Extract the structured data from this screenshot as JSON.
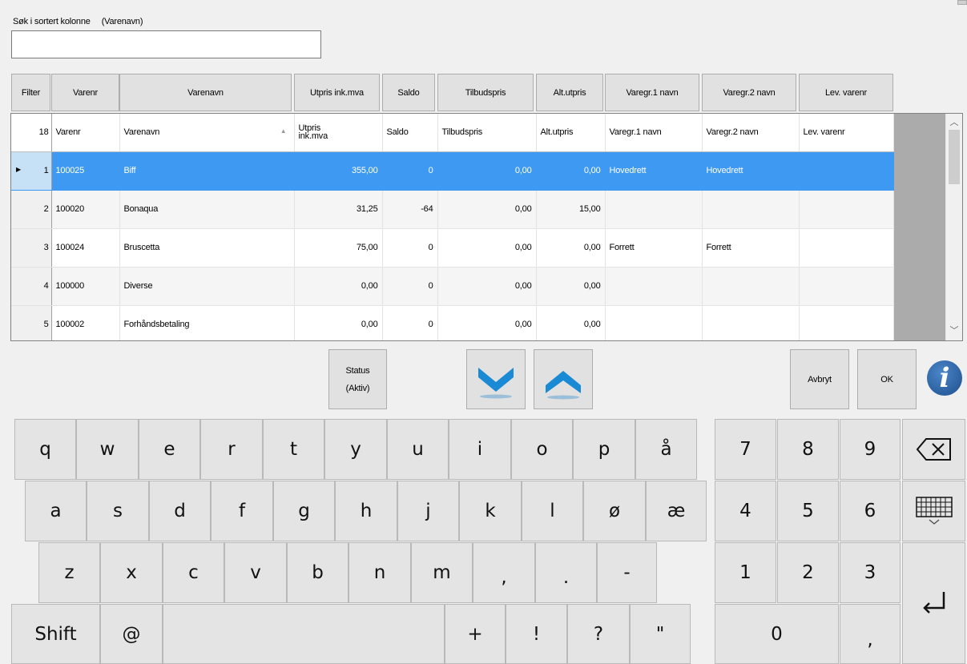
{
  "search": {
    "label": "Søk i sortert kolonne",
    "column_label": "(Varenavn)",
    "value": ""
  },
  "filter_buttons": [
    "Filter",
    "Varenr",
    "Varenavn",
    "Utpris ink.mva",
    "Saldo",
    "Tilbudspris",
    "Alt.utpris",
    "Varegr.1 navn",
    "Varegr.2 navn",
    "Lev. varenr"
  ],
  "grid": {
    "row_count": "18",
    "columns": [
      "Varenr",
      "Varenavn",
      "Utpris ink.mva",
      "Saldo",
      "Tilbudspris",
      "Alt.utpris",
      "Varegr.1 navn",
      "Varegr.2 navn",
      "Lev. varenr"
    ],
    "price_header_line1": "Utpris",
    "price_header_line2": "ink.mva",
    "rows": [
      {
        "n": "1",
        "varenr": "100025",
        "varenavn": "Biff",
        "utpris": "355,00",
        "saldo": "0",
        "tilbud": "0,00",
        "alt": "0,00",
        "vg1": "Hovedrett",
        "vg2": "Hovedrett",
        "lev": ""
      },
      {
        "n": "2",
        "varenr": "100020",
        "varenavn": "Bonaqua",
        "utpris": "31,25",
        "saldo": "-64",
        "tilbud": "0,00",
        "alt": "15,00",
        "vg1": "",
        "vg2": "",
        "lev": ""
      },
      {
        "n": "3",
        "varenr": "100024",
        "varenavn": "Bruscetta",
        "utpris": "75,00",
        "saldo": "0",
        "tilbud": "0,00",
        "alt": "0,00",
        "vg1": "Forrett",
        "vg2": "Forrett",
        "lev": ""
      },
      {
        "n": "4",
        "varenr": "100000",
        "varenavn": "Diverse",
        "utpris": "0,00",
        "saldo": "0",
        "tilbud": "0,00",
        "alt": "0,00",
        "vg1": "",
        "vg2": "",
        "lev": ""
      },
      {
        "n": "5",
        "varenr": "100002",
        "varenavn": "Forhåndsbetaling",
        "utpris": "0,00",
        "saldo": "0",
        "tilbud": "0,00",
        "alt": "0,00",
        "vg1": "",
        "vg2": "",
        "lev": ""
      }
    ],
    "selected_row": 1
  },
  "actions": {
    "status_line1": "Status",
    "status_line2": "(Aktiv)",
    "cancel": "Avbryt",
    "ok": "OK",
    "info": "i"
  },
  "keyboard": {
    "row1": [
      "q",
      "w",
      "e",
      "r",
      "t",
      "y",
      "u",
      "i",
      "o",
      "p",
      "å"
    ],
    "row2": [
      "a",
      "s",
      "d",
      "f",
      "g",
      "h",
      "j",
      "k",
      "l",
      "ø",
      "æ"
    ],
    "row3": [
      "z",
      "x",
      "c",
      "v",
      "b",
      "n",
      "m",
      ",",
      ".",
      "-"
    ],
    "row4": [
      "Shift",
      "@",
      "",
      "+",
      "!",
      "?",
      "\""
    ],
    "numpad": [
      "7",
      "8",
      "9",
      "4",
      "5",
      "6",
      "1",
      "2",
      "3",
      "0",
      ","
    ]
  },
  "colors": {
    "selection": "#3e99f3",
    "arrow_blue": "#1a8ad4",
    "info_blue": "#1d4f8e"
  }
}
